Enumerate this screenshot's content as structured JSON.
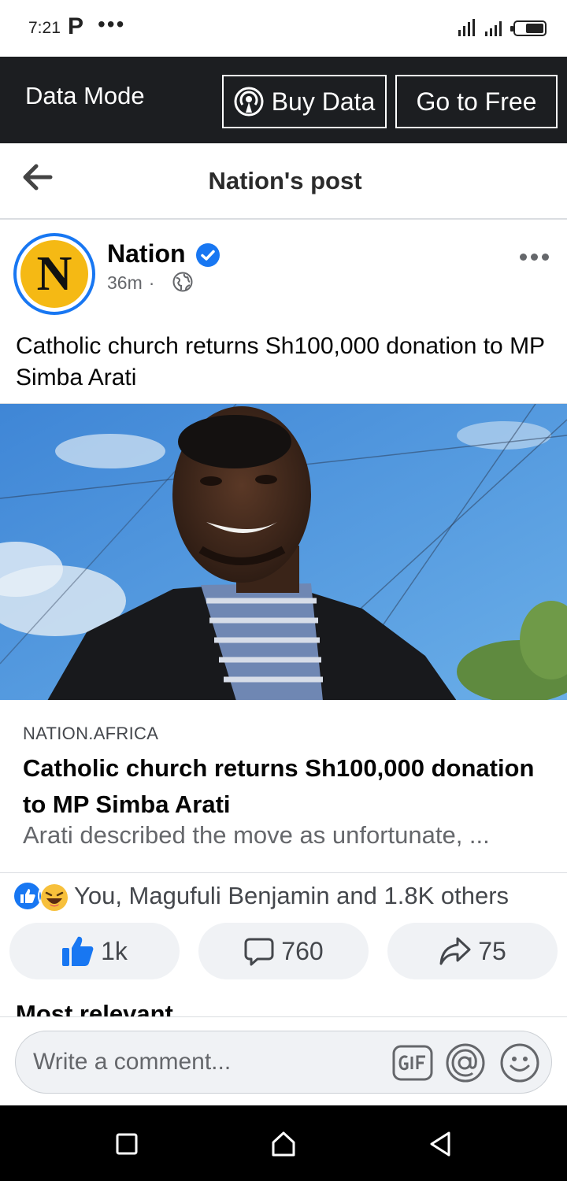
{
  "status_bar": {
    "time": "7:21",
    "app_icon": "P",
    "overflow": "•••"
  },
  "data_bar": {
    "label": "Data Mode",
    "buy_data": "Buy Data",
    "go_free": "Go to Free"
  },
  "header": {
    "title": "Nation's post"
  },
  "post": {
    "author": "Nation",
    "avatar_letter": "N",
    "time": "36m",
    "separator": "·",
    "text": "Catholic church returns Sh100,000 donation to MP Simba Arati"
  },
  "link_preview": {
    "domain": "NATION.AFRICA",
    "title": "Catholic church returns Sh100,000 donation to MP Simba Arati",
    "description": "Arati described the move as unfortunate, ..."
  },
  "reactions": {
    "summary": "You, Magufuli Benjamin and 1.8K others"
  },
  "actions": {
    "likes": "1k",
    "comments": "760",
    "shares": "75"
  },
  "comments_filter": "Most relevant",
  "composer": {
    "placeholder": "Write a comment..."
  },
  "colors": {
    "accent": "#1877f2",
    "dark_bar": "#1c1e21",
    "avatar_bg": "#f5b914"
  }
}
